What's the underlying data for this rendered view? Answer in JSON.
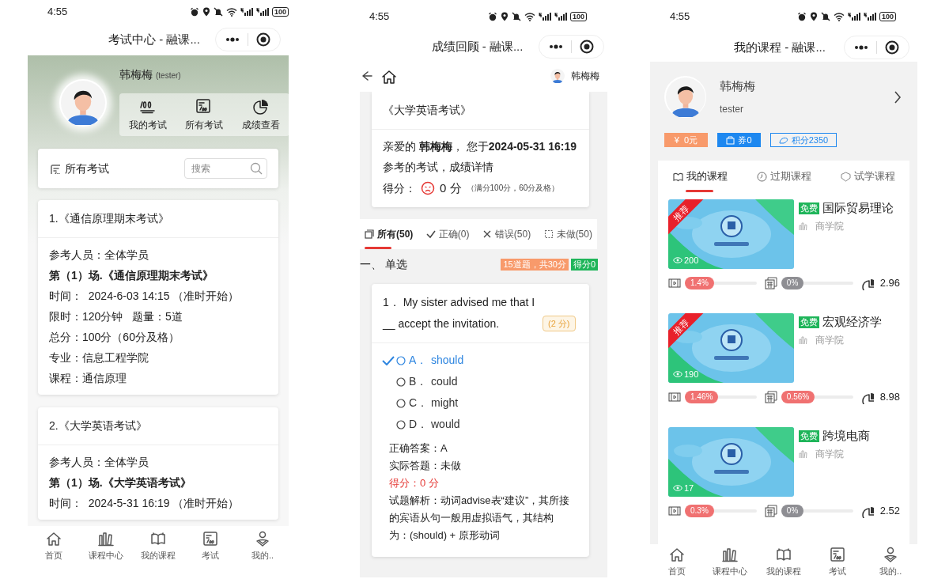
{
  "screens": [
    {
      "kind": "exam_center",
      "status_bar": {
        "time": "4:55",
        "battery": "100"
      },
      "title": "考试中心 - 融课...",
      "profile": {
        "name": "韩梅梅",
        "account": "(tester)"
      },
      "shortcuts": [
        {
          "kind": "score",
          "label": "我的考试"
        },
        {
          "kind": "paper",
          "label": "所有考试"
        },
        {
          "kind": "pie",
          "label": "成绩查看"
        }
      ],
      "section": {
        "title": "所有考试",
        "search_placeholder": "搜索"
      },
      "exams": [
        {
          "title": "1.《通信原理期末考试》",
          "lines": [
            {
              "text": "参考人员：全体学员",
              "bold": false
            },
            {
              "text": "第（1）场.《通信原理期末考试》",
              "bold": true
            },
            {
              "text": "时间：  2024-6-03 14:15 （准时开始）",
              "bold": false
            },
            {
              "text": "限时：120分钟   题量：5道",
              "bold": false
            },
            {
              "text": "总分：100分（60分及格）",
              "bold": false
            },
            {
              "text": "专业：信息工程学院",
              "bold": false
            },
            {
              "text": "课程：通信原理",
              "bold": false
            }
          ]
        },
        {
          "title": "2.《大学英语考试》",
          "lines": [
            {
              "text": "参考人员：全体学员",
              "bold": false
            },
            {
              "text": "第（1）场.《大学英语考试》",
              "bold": true
            },
            {
              "text": "时间：  2024-5-31 16:19 （准时开始）",
              "bold": false
            }
          ]
        }
      ],
      "tab_bar": [
        {
          "kind": "home",
          "label": "首页"
        },
        {
          "kind": "shelf",
          "label": "课程中心"
        },
        {
          "kind": "book",
          "label": "我的课程"
        },
        {
          "kind": "paper",
          "label": "考试"
        },
        {
          "kind": "user",
          "label": "我的.."
        }
      ]
    },
    {
      "kind": "score_review",
      "status_bar": {
        "time": "4:55",
        "battery": "100"
      },
      "title": "成绩回顾 - 融课...",
      "user": "韩梅梅",
      "exam_title": "《大学英语考试》",
      "message": "亲爱的 **韩梅梅**， 您于**2024-05-31 16:19**参考的考试，成绩详情",
      "score_label": "得分：",
      "score": "0 分",
      "score_note": "（满分100分，60分及格）",
      "filters": [
        {
          "kind": "all",
          "label": "所有(50)",
          "selected": true
        },
        {
          "kind": "correct",
          "label": "正确(0)",
          "selected": false
        },
        {
          "kind": "wrong",
          "label": "错误(50)",
          "selected": false
        },
        {
          "kind": "undone",
          "label": "未做(50)",
          "selected": false
        }
      ],
      "section": {
        "title": "一、 单选",
        "summary": "15道题，共30分",
        "score": "得分0"
      },
      "question": {
        "text": "1． My sister advised me that I __ accept the invitation.",
        "points": "(2 分)",
        "options": [
          {
            "letter": "A．",
            "text": "should",
            "correct": true
          },
          {
            "letter": "B．",
            "text": "could",
            "correct": false
          },
          {
            "letter": "C．",
            "text": "might",
            "correct": false
          },
          {
            "letter": "D．",
            "text": "would",
            "correct": false
          }
        ],
        "answer": "正确答案：A",
        "actual": "实际答题：未做",
        "score": "得分：0 分",
        "analysis": "试题解析：动词advise表“建议”，其所接的宾语从句一般用虚拟语气，其结构为：(should) + 原形动词"
      }
    },
    {
      "kind": "my_courses",
      "status_bar": {
        "time": "4:55",
        "battery": "100"
      },
      "title": "我的课程 - 融课...",
      "profile": {
        "name": "韩梅梅",
        "account": "tester"
      },
      "wallet": [
        {
          "kind": "balance",
          "label": "¥  0元"
        },
        {
          "kind": "coupon",
          "label": "券0"
        },
        {
          "kind": "points",
          "label": "积分2350"
        }
      ],
      "tabs": [
        {
          "kind": "book",
          "label": "我的课程",
          "selected": true
        },
        {
          "kind": "clock",
          "label": "过期课程",
          "selected": false
        },
        {
          "kind": "shield",
          "label": "试学课程",
          "selected": false
        }
      ],
      "courses": [
        {
          "badge": "推荐",
          "views": "200",
          "price_tag": "免费",
          "title": "国际贸易理论",
          "college": "商学院",
          "video_progress": {
            "text": "1.4%",
            "color": "#f07171"
          },
          "exercise_progress": {
            "text": "0%",
            "color": "#8e8e93"
          },
          "score": "2.96"
        },
        {
          "badge": "推荐",
          "views": "190",
          "price_tag": "免费",
          "title": "宏观经济学",
          "college": "商学院",
          "video_progress": {
            "text": "1.46%",
            "color": "#f07171"
          },
          "exercise_progress": {
            "text": "0.56%",
            "color": "#f07171"
          },
          "score": "8.98"
        },
        {
          "views": "17",
          "price_tag": "免费",
          "title": "跨境电商",
          "college": "商学院",
          "video_progress": {
            "text": "0.3%",
            "color": "#f07171"
          },
          "exercise_progress": {
            "text": "0%",
            "color": "#8e8e93"
          },
          "score": "2.52"
        }
      ],
      "tab_bar": [
        {
          "kind": "home",
          "label": "首页"
        },
        {
          "kind": "shelf",
          "label": "课程中心"
        },
        {
          "kind": "book",
          "label": "我的课程"
        },
        {
          "kind": "paper",
          "label": "考试"
        },
        {
          "kind": "user",
          "label": "我的.."
        }
      ]
    }
  ]
}
